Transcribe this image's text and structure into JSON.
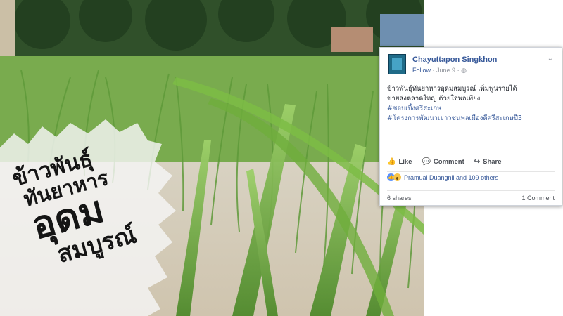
{
  "overlay_text": {
    "line1": "ข้าวพันธุ์",
    "line2": "ทันยาหาร",
    "line3": "อุดม",
    "line4": "สมบูรณ์"
  },
  "post": {
    "author": "Chayuttapon Singkhon",
    "follow_label": "Follow",
    "date": "June 9",
    "privacy_icon": "globe-icon",
    "text_line1": "ข้าวพันธุ์ทันยาหารอุดมสมบูรณ์ เพิ่มพูนรายได้",
    "text_line2": "ขายส่งตลาดใหญ่ ด้วยใจพอเพียง",
    "hashtag1": "#ชอบเบิ้งศรีสะเกษ",
    "hashtag2": "#โครงการพัฒนาเยาวชนพลเมืองดีศรีสะเกษปี3",
    "like_label": "Like",
    "comment_label": "Comment",
    "share_label": "Share",
    "reactions_text": "Pramual Duangnil and 109 others",
    "shares_text": "6 shares",
    "comments_text": "1 Comment"
  },
  "colors": {
    "link_blue": "#365899",
    "like_blue": "#5890ff",
    "grass_green": "#5f9a3a"
  }
}
